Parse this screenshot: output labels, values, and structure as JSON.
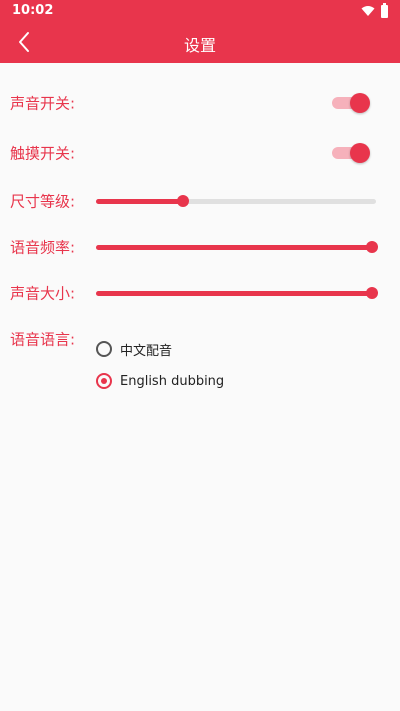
{
  "status_bar": {
    "time": "10:02"
  },
  "header": {
    "title": "设置"
  },
  "settings": {
    "sound_switch": {
      "label": "声音开关:",
      "on": true
    },
    "touch_switch": {
      "label": "触摸开关:",
      "on": true
    },
    "size_level": {
      "label": "尺寸等级:",
      "value_fraction": 0.31
    },
    "voice_frequency": {
      "label": "语音频率:",
      "value_fraction": 1.0
    },
    "volume": {
      "label": "声音大小:",
      "value_fraction": 1.0
    },
    "voice_language": {
      "label": "语音语言:",
      "options": [
        {
          "label": "中文配音",
          "selected": false
        },
        {
          "label": "English dubbing",
          "selected": true
        }
      ]
    }
  },
  "colors": {
    "accent": "#e8354c",
    "background": "#fafafa"
  }
}
